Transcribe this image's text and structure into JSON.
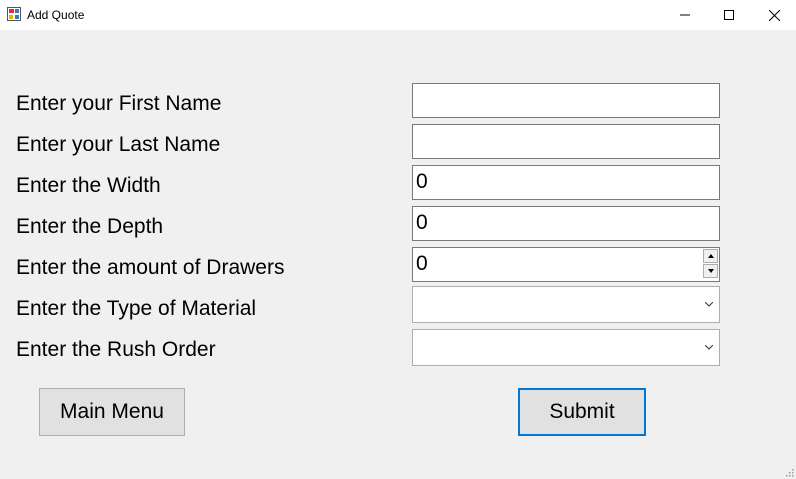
{
  "window": {
    "title": "Add Quote",
    "minimize_symbol": "—",
    "maximize_symbol": "☐",
    "close_symbol": "✕",
    "icon": "app-form-icon"
  },
  "form": {
    "fields": [
      {
        "label": "Enter your First Name",
        "value": ""
      },
      {
        "label": "Enter your Last Name",
        "value": ""
      },
      {
        "label": "Enter the Width",
        "value": "0"
      },
      {
        "label": "Enter the Depth",
        "value": "0"
      },
      {
        "label": "Enter the amount of Drawers",
        "value": "0"
      },
      {
        "label": "Enter the Type of Material",
        "value": ""
      },
      {
        "label": "Enter the Rush Order",
        "value": ""
      }
    ]
  },
  "buttons": {
    "main_menu": "Main Menu",
    "submit": "Submit"
  },
  "colors": {
    "background": "#f0f0f0",
    "focus_border": "#0078d7"
  }
}
